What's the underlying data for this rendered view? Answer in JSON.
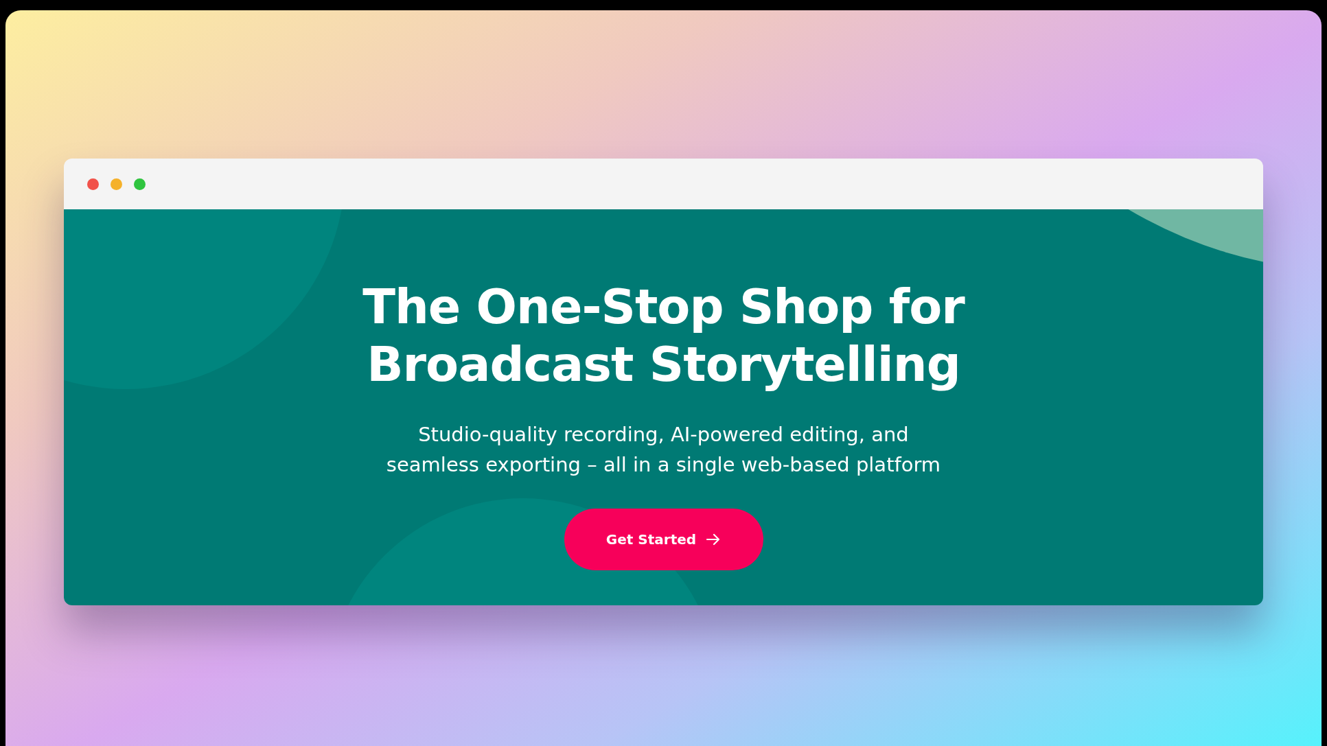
{
  "hero": {
    "heading_lines": [
      "The One-Stop Shop for",
      "Broadcast Storytelling"
    ],
    "subtitle_lines": [
      "Studio-quality recording, AI-powered editing, and",
      "seamless exporting – all in a single web-based platform"
    ],
    "button": "Get Started"
  }
}
